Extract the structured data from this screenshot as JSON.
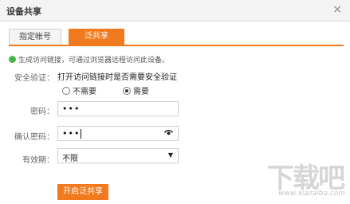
{
  "dialog": {
    "title": "设备共享",
    "close_glyph": "×"
  },
  "tabs": [
    {
      "label": "指定帐号",
      "active": false
    },
    {
      "label": "泛共享",
      "active": true
    }
  ],
  "info_text": "生成访问链接，可通过浏览器远程访问此设备。",
  "form": {
    "verify_label": "安全验证：",
    "verify_question": "打开访问链接时是否需要安全验证",
    "options": [
      {
        "label": "不需要",
        "selected": false
      },
      {
        "label": "需要",
        "selected": true
      }
    ],
    "password_label": "密码：",
    "password_value": "•••",
    "confirm_label": "确认密码：",
    "confirm_value": "•••",
    "expiry_label": "有效期：",
    "expiry_value": "不限"
  },
  "open_button_label": "开启泛共享",
  "watermark": {
    "logo_text": "下载吧",
    "url_text": "www.xiazaiba.com"
  },
  "colors": {
    "accent": "#f27a1e",
    "info_icon": "#46b54a"
  },
  "icons": {
    "info": "info-icon",
    "eye": "eye-icon",
    "dropdown": "chevron-down-icon"
  }
}
